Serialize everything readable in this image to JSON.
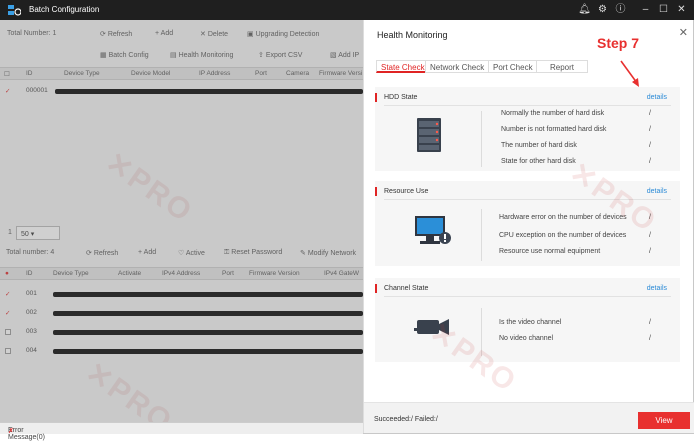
{
  "window": {
    "title": "Batch Configuration"
  },
  "left": {
    "total_number_top": "Total Number: 1",
    "toolbar_top": [
      "Refresh",
      "Add",
      "Delete",
      "Upgrading Detection"
    ],
    "toolbar_second": [
      "Batch Config",
      "Health Monitoring",
      "Export CSV",
      "Add IP"
    ],
    "columns_top": [
      "ID",
      "Device Type",
      "Device Model",
      "IP Address",
      "Port",
      "Camera",
      "Firmware Versi"
    ],
    "rows_top": [
      "000001"
    ],
    "pager_value": "50",
    "pager_prefix": "1",
    "total_number_bottom": "Total number: 4",
    "toolbar_bottom": [
      "Refresh",
      "Add",
      "Active",
      "Reset Password",
      "Modify Network"
    ],
    "columns_bottom": [
      "ID",
      "Device Type",
      "Activate",
      "IPv4 Address",
      "Port",
      "Firmware Version",
      "IPv4 GateW"
    ],
    "rows_bottom": [
      "001",
      "002",
      "003",
      "004"
    ],
    "error_message": "Error Message(0)"
  },
  "panel": {
    "title": "Health Monitoring",
    "tabs": [
      "State Check",
      "Network Check",
      "Port Check",
      "Report"
    ],
    "active_tab": "State Check",
    "sections": {
      "hdd": {
        "title": "HDD State",
        "details": "details",
        "stats": [
          {
            "label": "Normally the number of hard disk",
            "value": "/"
          },
          {
            "label": "Number is not formatted hard disk",
            "value": "/"
          },
          {
            "label": "The number of hard disk",
            "value": "/"
          },
          {
            "label": "State for other hard disk",
            "value": "/"
          }
        ]
      },
      "resource": {
        "title": "Resource Use",
        "details": "details",
        "stats": [
          {
            "label": "Hardware error on the number of devices",
            "value": "/"
          },
          {
            "label": "CPU exception on the number of devices",
            "value": "/"
          },
          {
            "label": "Resource use normal equipment",
            "value": "/"
          }
        ]
      },
      "channel": {
        "title": "Channel State",
        "details": "details",
        "stats": [
          {
            "label": "Is the video channel",
            "value": "/"
          },
          {
            "label": "No video channel",
            "value": "/"
          }
        ]
      }
    },
    "footer_status": "Succeeded:/  Failed:/",
    "view_label": "View"
  },
  "annotation": {
    "step": "Step 7"
  },
  "colors": {
    "accent": "#e8302f",
    "link": "#2a8ad6",
    "titlebar": "#1f1f1f"
  }
}
